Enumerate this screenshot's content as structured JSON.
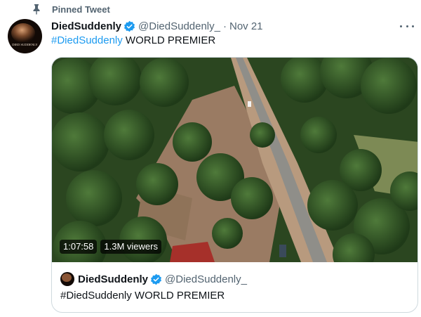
{
  "pinned": {
    "label": "Pinned Tweet",
    "icon": "pin-icon"
  },
  "tweet": {
    "author_name": "DiedSuddenly",
    "handle": "@DiedSuddenly_",
    "separator": "·",
    "date": "Nov 21",
    "hashtag": "#DiedSuddenly",
    "text_rest": " WORLD PREMIER",
    "avatar_caption": "DIED SUDDENLY"
  },
  "quote": {
    "author_name": "DiedSuddenly",
    "handle": "@DiedSuddenly_",
    "text": "#DiedSuddenly WORLD PREMIER"
  },
  "video": {
    "duration": "1:07:58",
    "viewers": "1.3M viewers"
  },
  "colors": {
    "accent": "#1d9bf0",
    "secondary_text": "#536471",
    "border": "#cfd9de"
  }
}
